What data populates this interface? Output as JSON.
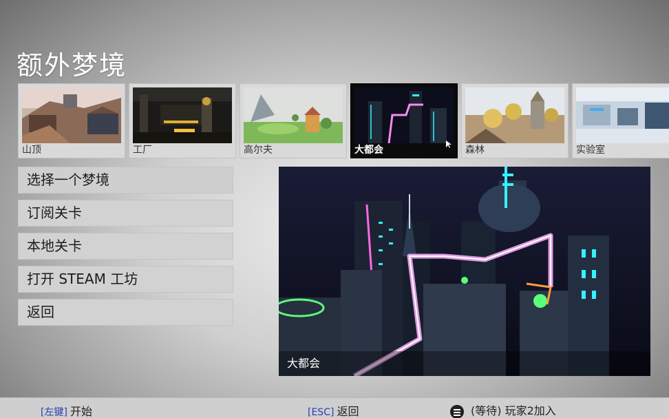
{
  "page": {
    "title": "额外梦境"
  },
  "levels": [
    {
      "name": "山顶",
      "selected": false,
      "icon": "mountain-scene"
    },
    {
      "name": "工厂",
      "selected": false,
      "icon": "factory-scene"
    },
    {
      "name": "高尔夫",
      "selected": false,
      "icon": "golf-scene"
    },
    {
      "name": "大都会",
      "selected": true,
      "icon": "city-scene"
    },
    {
      "name": "森林",
      "selected": false,
      "icon": "forest-scene"
    },
    {
      "name": "实验室",
      "selected": false,
      "icon": "lab-scene"
    }
  ],
  "menu": {
    "items": [
      {
        "label": "选择一个梦境"
      },
      {
        "label": "订阅关卡"
      },
      {
        "label": "本地关卡"
      },
      {
        "label": "打开 STEAM 工坊"
      },
      {
        "label": "返回"
      }
    ]
  },
  "preview": {
    "caption": "大都会"
  },
  "footer": {
    "start_key": "[左键]",
    "start_label": "开始",
    "back_key": "[ESC]",
    "back_label": "返回",
    "waiting_label": "(等待) 玩家2加入"
  },
  "colors": {
    "key_text": "#2a3fb0",
    "selected_thumb": "#0b0b0b",
    "neon_pink": "#ff7af0",
    "neon_cyan": "#38f0ff"
  }
}
